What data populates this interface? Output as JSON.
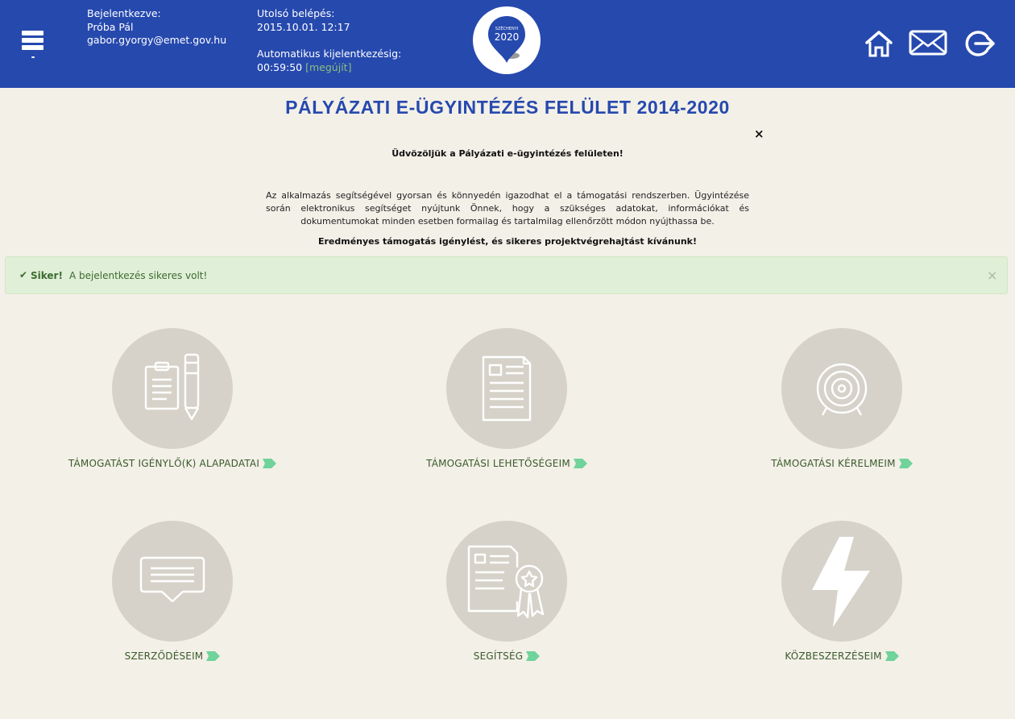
{
  "header": {
    "menu_icon": "hamburger-menu-icon",
    "user": {
      "label": "Bejelentkezve:",
      "name": "Próba Pál",
      "email": "gabor.gyorgy@emet.gov.hu"
    },
    "last_login": {
      "label": "Utolsó belépés:",
      "value": "2015.10.01. 12:17"
    },
    "auto_logout": {
      "label": "Automatikus kijelentkezésig:",
      "value": "00:59:50",
      "renew_link": "[megújít]"
    },
    "logo": {
      "top_text": "SZÉCHENYI",
      "year": "2020"
    },
    "icons": [
      "home-icon",
      "mail-icon",
      "logout-icon"
    ]
  },
  "title": "PÁLYÁZATI E-ÜGYINTÉZÉS FELÜLET 2014-2020",
  "welcome": {
    "close": "×",
    "heading": "Üdvözöljük a Pályázati e-ügyintézés felületen!",
    "body": "Az alkalmazás segítségével gyorsan és könnyedén igazodhat el a támogatási rendszerben. Ügyintézése során elektronikus segítséget nyújtunk Önnek, hogy a szükséges adatokat, információkat és dokumentumokat minden esetben formailag és tartalmilag ellenőrzött módon nyújthassa be.",
    "wish": "Eredményes támogatás igénylést, és sikeres projektvégrehajtást kívánunk!"
  },
  "alert": {
    "strong": "Siker!",
    "message": "A bejelentkezés sikeres volt!",
    "close": "×"
  },
  "tiles": [
    {
      "label": "TÁMOGATÁST IGÉNYLŐ(K) ALAPADATAI",
      "icon": "clipboard-pencil-icon"
    },
    {
      "label": "TÁMOGATÁSI LEHETŐSÉGEIM",
      "icon": "document-icon"
    },
    {
      "label": "TÁMOGATÁSI KÉRELMEIM",
      "icon": "target-icon"
    },
    {
      "label": "SZERZŐDÉSEIM",
      "icon": "chat-bubble-icon"
    },
    {
      "label": "SEGÍTSÉG",
      "icon": "certificate-icon"
    },
    {
      "label": "KÖZBESZERZÉSEIM",
      "icon": "lightning-icon"
    }
  ],
  "colors": {
    "header_bg": "#2649ae",
    "page_bg": "#f3f0e8",
    "tile_circle": "#d6d2c9",
    "alert_bg": "#e0efd8",
    "arrow_green": "#6fd39a"
  }
}
